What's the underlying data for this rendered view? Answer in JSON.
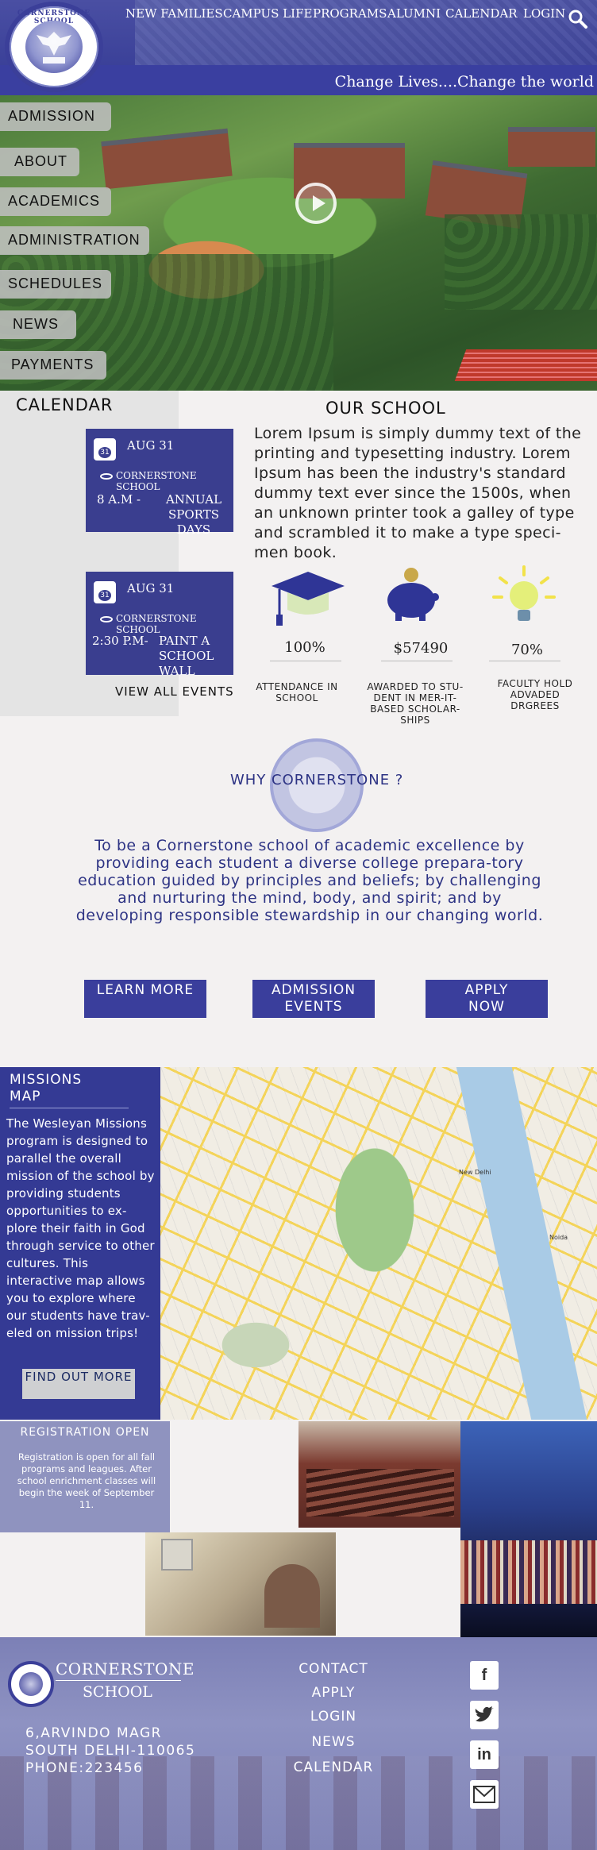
{
  "header": {
    "logo_text": "CORNERSTONE SCHOOL",
    "nav": [
      "NEW FAMILIES",
      "CAMPUS LIFE",
      "PROGRAMS",
      "ALUMNI",
      "CALENDAR",
      "LOGIN"
    ],
    "search_icon": "search-icon",
    "tagline": "Change Lives....Change the world"
  },
  "sidebar": {
    "items": [
      "ADMISSION",
      "ABOUT",
      "ACADEMICS",
      "ADMINISTRATION",
      "SCHEDULES",
      "NEWS",
      "PAYMENTS"
    ]
  },
  "hero": {
    "play_icon": "play-icon"
  },
  "calendar": {
    "title": "CALENDAR",
    "events": [
      {
        "day": "31",
        "date": "AUG 31",
        "location": "CORNERSTONE SCHOOL",
        "time": "8 A.M -",
        "desc": "ANNUAL SPORTS DAYS"
      },
      {
        "day": "31",
        "date": "AUG 31",
        "location": "CORNERSTONE SCHOOL",
        "time": "2:30 P.M-",
        "desc": "PAINT A SCHOOL WALL"
      }
    ],
    "view_all": "VIEW ALL EVENTS"
  },
  "our_school": {
    "title": "OUR SCHOOL",
    "body": "Lorem Ipsum is simply dummy text of the printing and typesetting industry. Lorem Ipsum has been the industry's standard dummy text ever since the 1500s, when an unknown printer took a galley of type and scrambled it to make a type speci-men book.",
    "stats": [
      {
        "icon": "graduation-cap-icon",
        "value": "100%",
        "label": "ATTENDANCE IN SCHOOL"
      },
      {
        "icon": "piggy-bank-icon",
        "value": "$57490",
        "label": "AWARDED TO STU-DENT IN MER-IT-BASED SCHOLAR-SHIPS"
      },
      {
        "icon": "lightbulb-icon",
        "value": "70%",
        "label": "FACULTY HOLD ADVADED DRGREES"
      }
    ]
  },
  "why": {
    "title": "WHY CORNERSTONE ?",
    "body": "To be a Cornerstone school of academic excellence by providing each student a diverse college prepara-tory education guided by principles and beliefs; by challenging and nurturing the mind, body, and spirit; and by developing responsible stewardship in our changing world.",
    "buttons": [
      "LEARN MORE",
      "ADMISSION EVENTS",
      "APPLY NOW"
    ]
  },
  "missions": {
    "title": "MISSIONS MAP",
    "body": "The Wesleyan Missions program is designed to parallel the overall mission of the school by providing students opportunities to ex-plore their faith in God through service to other cultures. This interactive map allows you to explore where our students have trav-eled on mission trips!",
    "button": "FIND OUT MORE",
    "map_labels": [
      "New Delhi",
      "Noida"
    ]
  },
  "gallery": {
    "registration_title": "REGISTRATION OPEN",
    "registration_body": "Registration is open for all fall programs and leagues. After school enrichment classes will begin the week of September 11."
  },
  "footer": {
    "name_line1": "CORNERSTONE",
    "name_line2": "SCHOOL",
    "address": [
      "6,ARVINDO MAGR",
      "SOUTH DELHI-110065",
      "PHONE:223456"
    ],
    "links": [
      "CONTACT",
      "APPLY",
      "LOGIN",
      "NEWS",
      "CALENDAR"
    ],
    "social": [
      "facebook-icon",
      "twitter-icon",
      "linkedin-icon",
      "mail-icon"
    ]
  },
  "colors": {
    "brand": "#3a3f9c",
    "panel": "#343a94",
    "accent": "#f4d45a"
  }
}
